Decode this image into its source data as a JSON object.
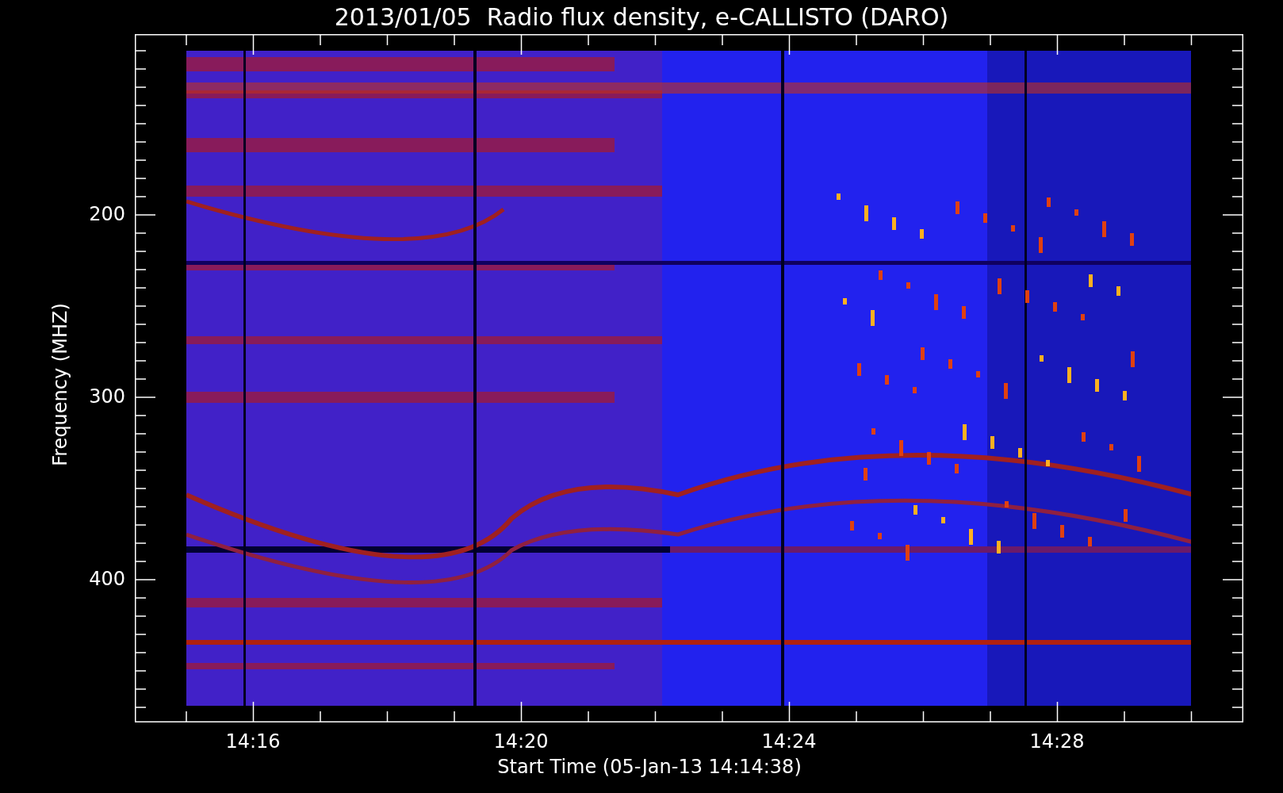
{
  "title": "2013/01/05  Radio flux density, e-CALLISTO (DARO)",
  "y_axis": {
    "label": "Frequency (MHZ)",
    "ticks": [
      "200",
      "300",
      "400"
    ]
  },
  "x_axis": {
    "label": "Start Time (05-Jan-13 14:14:38)",
    "ticks": [
      "14:16",
      "14:20",
      "14:24",
      "14:28"
    ]
  }
}
